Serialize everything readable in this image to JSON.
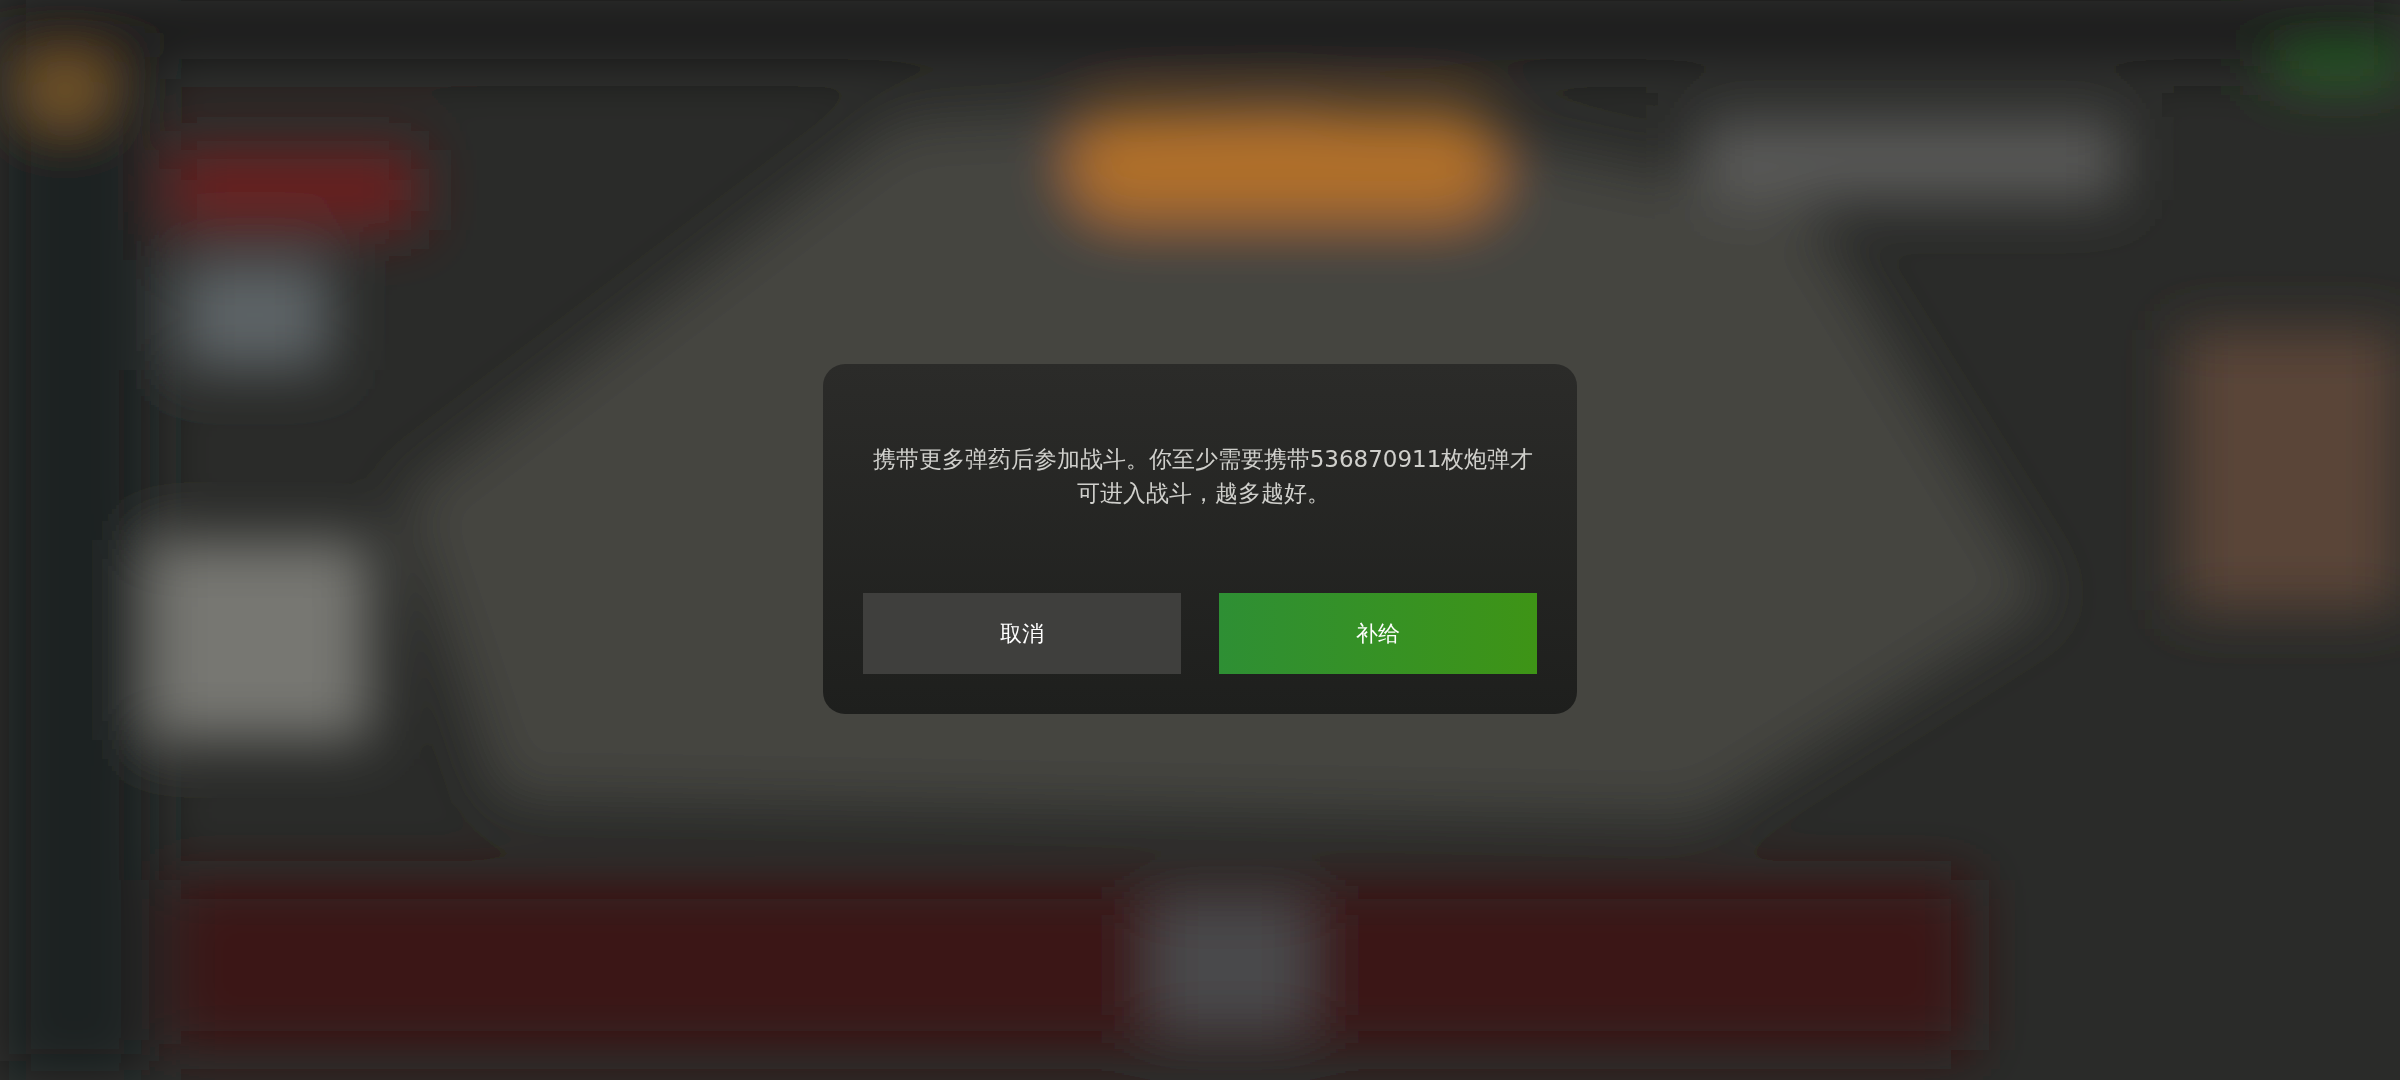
{
  "dialog": {
    "message": "携带更多弹药后参加战斗。你至少需要携带536870911枚炮弹才可进入战斗，越多越好。",
    "buttons": [
      {
        "label": "取消",
        "kind": "secondary"
      },
      {
        "label": "补给",
        "kind": "primary"
      }
    ]
  }
}
